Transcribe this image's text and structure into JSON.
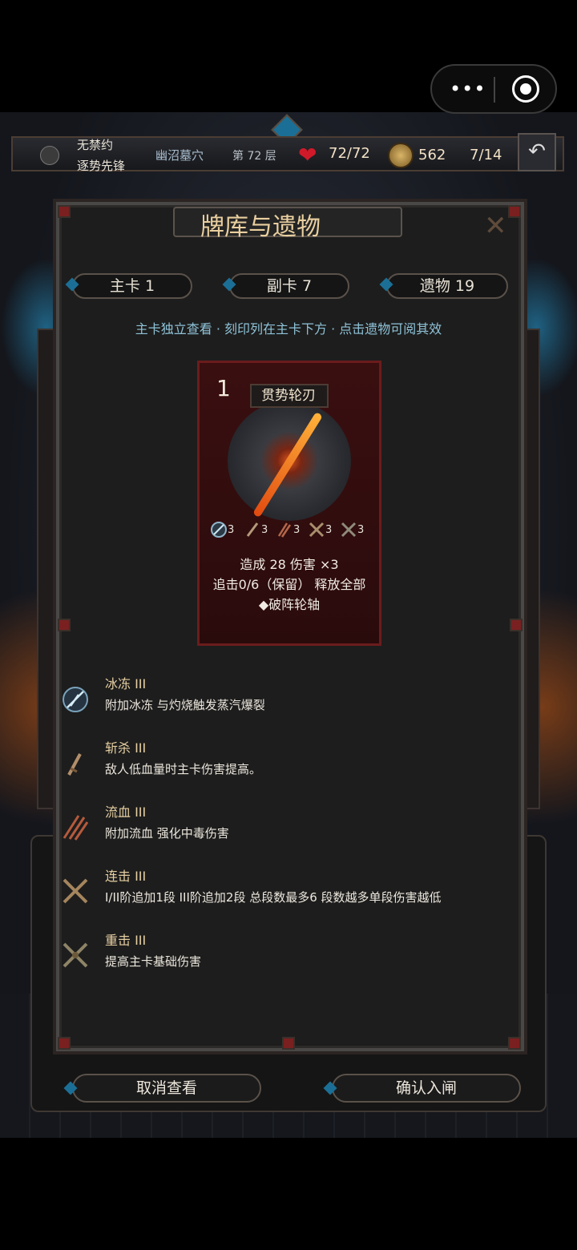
{
  "hud": {
    "line1": "无禁约",
    "line2": "逐势先锋",
    "location": "幽沼墓穴",
    "floor": "第 72 层",
    "hp": "72/72",
    "gold": "562",
    "progress": "7/14",
    "back_icon": "↶"
  },
  "capsule": {
    "more": "•••"
  },
  "dialog": {
    "title": "牌库与遗物",
    "close_glyph": "✕",
    "tabs": [
      {
        "label": "主卡  1"
      },
      {
        "label": "副卡  7"
      },
      {
        "label": "遗物  19"
      }
    ],
    "hint": "主卡独立查看 · 刻印列在主卡下方 · 点击遗物可阅其效"
  },
  "card": {
    "number": "1",
    "name": "贯势轮刃",
    "imprints": [
      "3",
      "3",
      "3",
      "3",
      "3"
    ],
    "line1": "造成 28 伤害 ×3",
    "line2": "追击0/6（保留） 释放全部",
    "line3": "◆破阵轮轴"
  },
  "relics": [
    {
      "name": "冰冻  III",
      "desc": "附加冰冻 与灼烧触发蒸汽爆裂",
      "icon": "ice-shard-icon"
    },
    {
      "name": "斩杀  III",
      "desc": "敌人低血量时主卡伤害提高。",
      "icon": "dagger-icon"
    },
    {
      "name": "流血  III",
      "desc": "附加流血 强化中毒伤害",
      "icon": "claw-icon"
    },
    {
      "name": "连击  III",
      "desc": "I/II阶追加1段 III阶追加2段 总段数最多6 段数越多单段伤害越低",
      "icon": "crossed-blades-icon"
    },
    {
      "name": "重击  III",
      "desc": "提高主卡基础伤害",
      "icon": "crossed-swords-icon"
    }
  ],
  "buttons": {
    "cancel": "取消查看",
    "confirm": "确认入闸"
  },
  "colors": {
    "accent_gold": "#e9cf9f",
    "hint_blue": "#8fc3d8",
    "card_red": "#6b1c1c",
    "heart_red": "#d01a2a"
  }
}
